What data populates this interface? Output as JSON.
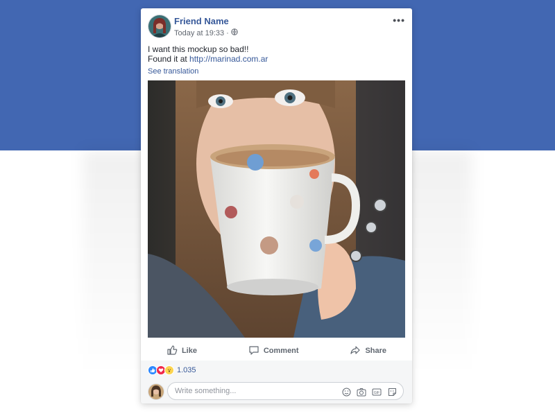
{
  "post": {
    "author_name": "Friend Name",
    "timestamp": "Today at 19:33",
    "meta_separator": "·",
    "privacy_icon": "globe-icon",
    "more_icon": "ellipsis-icon",
    "more_label": "•••",
    "text_line1": "I want this mockup so bad!!",
    "text_line2_prefix": "Found it at",
    "link": "http://marinad.com.ar",
    "see_translation": "See translation"
  },
  "actions": {
    "like_label": "Like",
    "comment_label": "Comment",
    "share_label": "Share",
    "like_icon": "thumbs-up-icon",
    "comment_icon": "comment-bubble-icon",
    "share_icon": "share-arrow-icon"
  },
  "reactions": {
    "icons": [
      "like-reaction-icon",
      "love-reaction-icon",
      "wow-reaction-icon"
    ],
    "count": "1.035"
  },
  "comment": {
    "placeholder": "Write something...",
    "icons": [
      "emoji-icon",
      "camera-icon",
      "gif-icon",
      "sticker-icon"
    ]
  },
  "colors": {
    "brand_blue": "#4267b2",
    "link_blue": "#365899",
    "like_blue": "#2e89ff",
    "love_red": "#f0284a",
    "wow_yellow": "#fcd44f"
  }
}
